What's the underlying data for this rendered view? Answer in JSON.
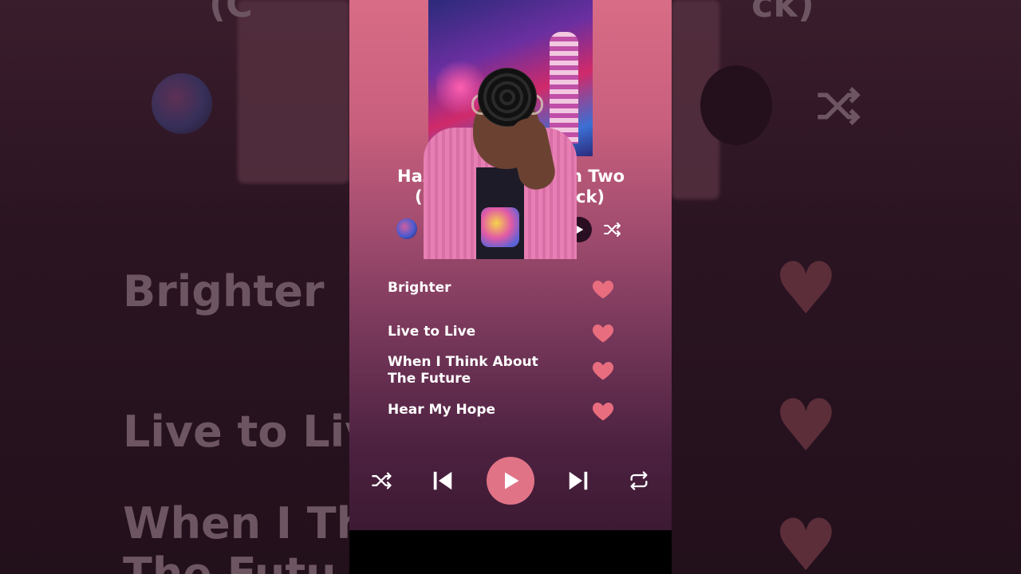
{
  "album": {
    "title_line1": "Haz",
    "title_line1_end": "n Two",
    "title_line2_start": "(",
    "title_line2_end": "ck)"
  },
  "tracks": [
    {
      "title": "Brighter",
      "liked": true
    },
    {
      "title": "Live to Live",
      "liked": true
    },
    {
      "title": "When I Think About\nThe Future",
      "liked": true
    },
    {
      "title": "Hear My Hope",
      "liked": true
    }
  ],
  "background": {
    "left_track_1": "Brighter",
    "left_track_2": "Live to Live",
    "left_track_3a": "When I Thi",
    "left_track_3b": "The Futu",
    "top_left_text": "(C",
    "top_right_text": "ck)"
  },
  "colors": {
    "accent": "#e17387",
    "heart": "#e86d7e",
    "text": "#ffffff"
  },
  "icons": {
    "shuffle": "shuffle-icon",
    "previous": "skip-previous-icon",
    "play": "play-icon",
    "next": "skip-next-icon",
    "repeat": "repeat-icon",
    "heart": "heart-icon"
  }
}
